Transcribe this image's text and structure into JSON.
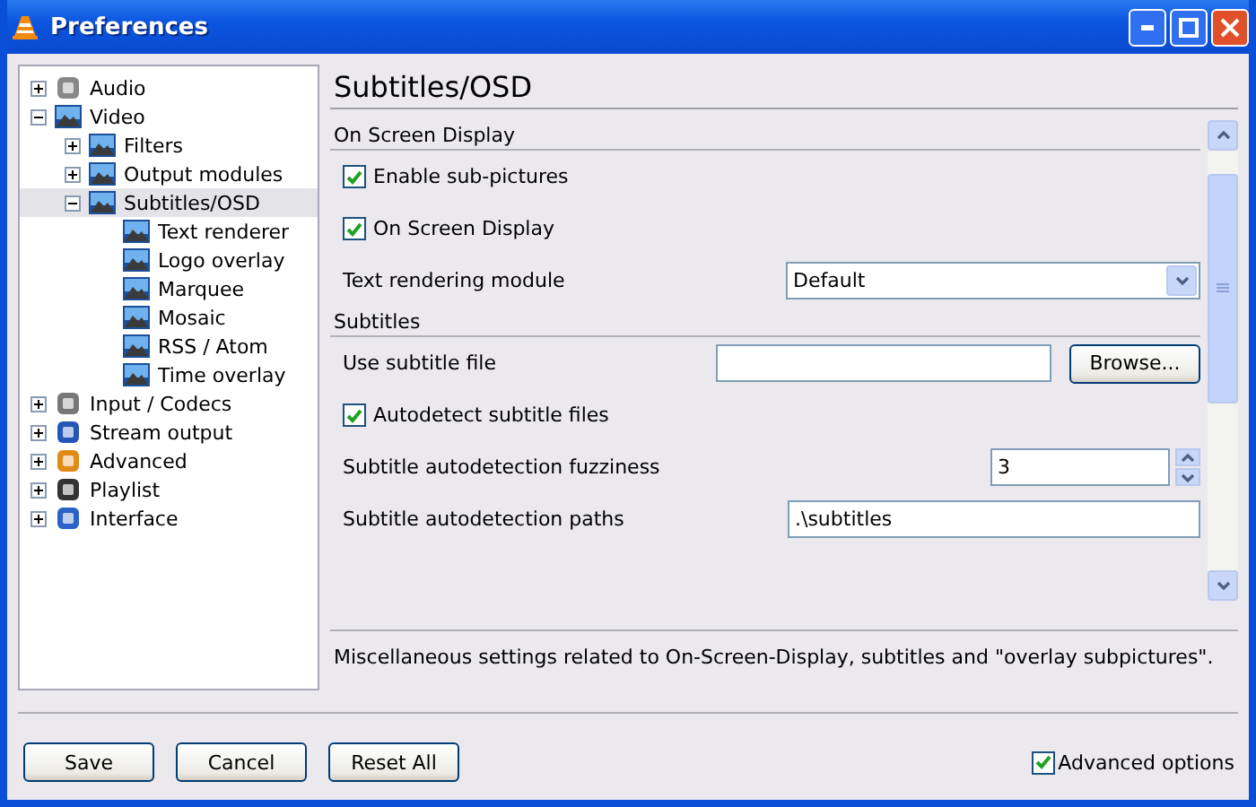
{
  "window": {
    "title": "Preferences"
  },
  "tree": [
    {
      "label": "Audio",
      "expanded": false,
      "selected": false
    },
    {
      "label": "Video",
      "expanded": true,
      "selected": false,
      "children": [
        {
          "label": "Filters",
          "expanded": false,
          "selected": false
        },
        {
          "label": "Output modules",
          "expanded": false,
          "selected": false
        },
        {
          "label": "Subtitles/OSD",
          "expanded": true,
          "selected": true,
          "children": [
            {
              "label": "Text renderer",
              "selected": false
            },
            {
              "label": "Logo overlay",
              "selected": false
            },
            {
              "label": "Marquee",
              "selected": false
            },
            {
              "label": "Mosaic",
              "selected": false
            },
            {
              "label": "RSS / Atom",
              "selected": false
            },
            {
              "label": "Time overlay",
              "selected": false
            }
          ]
        }
      ]
    },
    {
      "label": "Input / Codecs",
      "expanded": false,
      "selected": false
    },
    {
      "label": "Stream output",
      "expanded": false,
      "selected": false
    },
    {
      "label": "Advanced",
      "expanded": false,
      "selected": false
    },
    {
      "label": "Playlist",
      "expanded": false,
      "selected": false
    },
    {
      "label": "Interface",
      "expanded": false,
      "selected": false
    }
  ],
  "panel": {
    "title": "Subtitles/OSD",
    "settings": [
      {
        "kind": "section",
        "label": "On Screen Display"
      },
      {
        "kind": "checkbox",
        "label": "Enable sub-pictures",
        "checked": true
      },
      {
        "kind": "checkbox",
        "label": "On Screen Display",
        "checked": true
      },
      {
        "kind": "select",
        "label": "Text rendering module",
        "value": "Default"
      },
      {
        "kind": "section",
        "label": "Subtitles"
      },
      {
        "kind": "file",
        "label": "Use subtitle file",
        "button": "Browse..."
      },
      {
        "kind": "checkbox",
        "label": "Autodetect subtitle files",
        "checked": true
      },
      {
        "kind": "spin",
        "label": "Subtitle autodetection fuzziness",
        "value": "3"
      },
      {
        "kind": "text",
        "label": "Subtitle autodetection paths",
        "value": ".\\subtitles"
      }
    ],
    "description": "Miscellaneous settings related to On-Screen-Display, subtitles and \"overlay subpictures\"."
  },
  "buttons": [
    "Save",
    "Cancel",
    "Reset All"
  ],
  "advanced_options": {
    "label": "Advanced options",
    "checked": true
  }
}
